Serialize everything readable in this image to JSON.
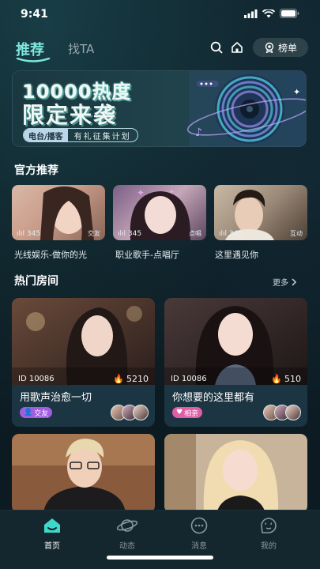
{
  "status_bar": {
    "time": "9:41"
  },
  "header": {
    "tabs": [
      {
        "label": "推荐",
        "active": true
      },
      {
        "label": "找TA",
        "active": false
      }
    ],
    "rank_label": "榜单"
  },
  "banner": {
    "title_line1": "10000热度",
    "title_line2": "限定来袭",
    "pill_left": "电台/播客",
    "pill_right": "有礼征集计划"
  },
  "official": {
    "title": "官方推荐",
    "cards": [
      {
        "count": "345",
        "tag": "交友",
        "label": "光线娱乐-做你的光"
      },
      {
        "count": "345",
        "tag": "点唱",
        "label": "职业歌手-点唱厅"
      },
      {
        "count": "345",
        "tag": "互动",
        "label": "这里遇见你"
      }
    ]
  },
  "hot_rooms": {
    "title": "热门房间",
    "more_label": "更多",
    "rooms": [
      {
        "id": "ID 10086",
        "heat": "5210",
        "title": "用歌声治愈一切",
        "tag": "交友",
        "tag_color": "#a05de0"
      },
      {
        "id": "ID 10086",
        "heat": "510",
        "title": "你想要的这里都有",
        "tag": "相亲",
        "tag_color": "#e05da8"
      },
      {
        "id": "",
        "heat": "",
        "title": "",
        "tag": "",
        "tag_color": ""
      },
      {
        "id": "",
        "heat": "",
        "title": "",
        "tag": "",
        "tag_color": ""
      }
    ]
  },
  "bottom_nav": [
    {
      "label": "首页",
      "icon": "home-icon",
      "active": true
    },
    {
      "label": "动态",
      "icon": "planet-icon",
      "active": false
    },
    {
      "label": "消息",
      "icon": "chat-icon",
      "active": false
    },
    {
      "label": "我的",
      "icon": "profile-icon",
      "active": false
    }
  ],
  "colors": {
    "accent": "#7fe6df",
    "background": "#0d1b22"
  }
}
